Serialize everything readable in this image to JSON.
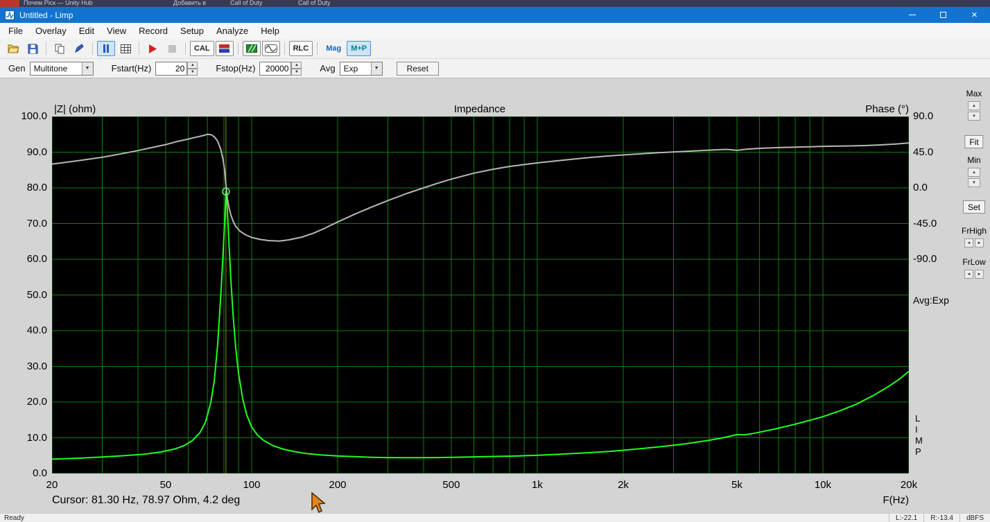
{
  "background_tabs": {
    "fragments": [
      "Почем Ріск — Unity Hub",
      "Добавить в",
      "Call of Duty",
      "Call of Duty"
    ]
  },
  "window": {
    "title": "Untitled - Limp"
  },
  "menubar": {
    "items": [
      "File",
      "Overlay",
      "Edit",
      "View",
      "Record",
      "Setup",
      "Analyze",
      "Help"
    ]
  },
  "toolbar": {
    "icons": [
      "open-file-icon",
      "save-icon",
      "copy-icon",
      "pen-icon",
      "pause-icon",
      "table-icon",
      "record-icon",
      "stop-icon",
      "color-bars-icon",
      "spectrum-icon",
      "waveform-icon"
    ],
    "cal_label": "CAL",
    "rlc_label": "RLC",
    "mag_label": "Mag",
    "mp_label": "M+P"
  },
  "controls": {
    "gen_label": "Gen",
    "gen_value": "Multitone",
    "fstart_label": "Fstart(Hz)",
    "fstart_value": "20",
    "fstop_label": "Fstop(Hz)",
    "fstop_value": "20000",
    "avg_label": "Avg",
    "avg_value": "Exp",
    "reset_label": "Reset"
  },
  "chart_data": {
    "type": "line",
    "title": "Impedance",
    "ylabel_left": "|Z| (ohm)",
    "ylabel_right": "Phase (°)",
    "xlabel": "F(Hz)",
    "x_scale": "log",
    "fmin": 20,
    "fmax": 20000,
    "grid": true,
    "z_axis": {
      "min": 0,
      "max": 100,
      "ticks": [
        "100.0",
        "90.0",
        "80.0",
        "70.0",
        "60.0",
        "50.0",
        "40.0",
        "30.0",
        "20.0",
        "10.0",
        "0.0"
      ]
    },
    "phase_axis": {
      "min": -90,
      "max": 90,
      "ticks": [
        "90.0",
        "45.0",
        "0.0",
        "-45.0",
        "-90.0"
      ]
    },
    "x_ticks": [
      {
        "f": 20,
        "label": "20"
      },
      {
        "f": 50,
        "label": "50"
      },
      {
        "f": 100,
        "label": "100"
      },
      {
        "f": 200,
        "label": "200"
      },
      {
        "f": 500,
        "label": "500"
      },
      {
        "f": 1000,
        "label": "1k"
      },
      {
        "f": 2000,
        "label": "2k"
      },
      {
        "f": 5000,
        "label": "5k"
      },
      {
        "f": 10000,
        "label": "10k"
      },
      {
        "f": 20000,
        "label": "20k"
      }
    ],
    "cursor": {
      "freq": 81.3,
      "z": 78.97,
      "phase": 4.2,
      "readout": "Cursor: 81.30 Hz, 78.97 Ohm, 4.2 deg"
    },
    "colors": {
      "plot_bg": "#000000",
      "grid": "#0e800e",
      "cursor_line": "#8b8b00",
      "marker": "#5cff5c"
    },
    "series": [
      {
        "name": "impedance",
        "axis": "z",
        "color": "#1fff1f",
        "points": [
          [
            20,
            4.0
          ],
          [
            25,
            4.3
          ],
          [
            30,
            4.6
          ],
          [
            36,
            5.0
          ],
          [
            42,
            5.4
          ],
          [
            48,
            6.0
          ],
          [
            54,
            6.9
          ],
          [
            58,
            7.8
          ],
          [
            62,
            9.2
          ],
          [
            66,
            11.5
          ],
          [
            69,
            14.5
          ],
          [
            72,
            20
          ],
          [
            74,
            26
          ],
          [
            76,
            36
          ],
          [
            78,
            50
          ],
          [
            79.5,
            62
          ],
          [
            80.5,
            71
          ],
          [
            81.3,
            78.97
          ],
          [
            82.2,
            74
          ],
          [
            83.2,
            65
          ],
          [
            84.5,
            55
          ],
          [
            86,
            45
          ],
          [
            88,
            35
          ],
          [
            90,
            28
          ],
          [
            93,
            21
          ],
          [
            96,
            16.5
          ],
          [
            100,
            13
          ],
          [
            105,
            10.7
          ],
          [
            110,
            9.3
          ],
          [
            118,
            7.9
          ],
          [
            128,
            6.9
          ],
          [
            140,
            6.2
          ],
          [
            155,
            5.6
          ],
          [
            175,
            5.2
          ],
          [
            200,
            4.9
          ],
          [
            230,
            4.7
          ],
          [
            260,
            4.55
          ],
          [
            300,
            4.45
          ],
          [
            360,
            4.4
          ],
          [
            430,
            4.45
          ],
          [
            500,
            4.5
          ],
          [
            600,
            4.65
          ],
          [
            700,
            4.75
          ],
          [
            850,
            4.9
          ],
          [
            1000,
            5.1
          ],
          [
            1200,
            5.4
          ],
          [
            1500,
            5.8
          ],
          [
            1800,
            6.2
          ],
          [
            2200,
            6.8
          ],
          [
            2700,
            7.5
          ],
          [
            3300,
            8.3
          ],
          [
            4000,
            9.3
          ],
          [
            4600,
            10.2
          ],
          [
            5000,
            10.9
          ],
          [
            5300,
            10.8
          ],
          [
            5700,
            11.2
          ],
          [
            6300,
            11.9
          ],
          [
            7000,
            12.7
          ],
          [
            8000,
            13.8
          ],
          [
            9000,
            14.9
          ],
          [
            10000,
            15.9
          ],
          [
            11500,
            17.6
          ],
          [
            13000,
            19.3
          ],
          [
            15000,
            21.8
          ],
          [
            17000,
            24.4
          ],
          [
            18500,
            26.4
          ],
          [
            20000,
            28.6
          ]
        ]
      },
      {
        "name": "phase",
        "axis": "phase",
        "color": "#b8b8b8",
        "points": [
          [
            20,
            30
          ],
          [
            25,
            34.5
          ],
          [
            30,
            38.5
          ],
          [
            35,
            43
          ],
          [
            40,
            47
          ],
          [
            45,
            51
          ],
          [
            50,
            54.5
          ],
          [
            55,
            58.5
          ],
          [
            60,
            61.5
          ],
          [
            64,
            64
          ],
          [
            67,
            65.5
          ],
          [
            70,
            67.5
          ],
          [
            72,
            67
          ],
          [
            74,
            64.5
          ],
          [
            76,
            59
          ],
          [
            78,
            48.5
          ],
          [
            79.5,
            35
          ],
          [
            80.5,
            21
          ],
          [
            81.3,
            4.2
          ],
          [
            82.2,
            -13
          ],
          [
            83.2,
            -24
          ],
          [
            84.5,
            -33.5
          ],
          [
            86,
            -41.5
          ],
          [
            88,
            -48.5
          ],
          [
            91,
            -54.5
          ],
          [
            95,
            -59
          ],
          [
            100,
            -62.5
          ],
          [
            107,
            -65
          ],
          [
            115,
            -66.5
          ],
          [
            125,
            -67
          ],
          [
            135,
            -65.5
          ],
          [
            150,
            -62
          ],
          [
            165,
            -57
          ],
          [
            180,
            -51
          ],
          [
            200,
            -43
          ],
          [
            230,
            -33
          ],
          [
            260,
            -25
          ],
          [
            300,
            -16
          ],
          [
            350,
            -7
          ],
          [
            400,
            0
          ],
          [
            450,
            6
          ],
          [
            500,
            11
          ],
          [
            600,
            18.5
          ],
          [
            700,
            23.5
          ],
          [
            800,
            27
          ],
          [
            1000,
            31.5
          ],
          [
            1200,
            34.5
          ],
          [
            1500,
            38
          ],
          [
            1800,
            40.5
          ],
          [
            2200,
            42.5
          ],
          [
            2700,
            44.5
          ],
          [
            3300,
            46
          ],
          [
            4000,
            47.5
          ],
          [
            4600,
            48.5
          ],
          [
            5000,
            47.3
          ],
          [
            5400,
            48.8
          ],
          [
            6000,
            49.8
          ],
          [
            7000,
            50.8
          ],
          [
            8000,
            51.3
          ],
          [
            9000,
            51.8
          ],
          [
            10000,
            52.3
          ],
          [
            12000,
            52.8
          ],
          [
            14000,
            53.3
          ],
          [
            16000,
            54.2
          ],
          [
            18000,
            55.2
          ],
          [
            20000,
            56.5
          ]
        ]
      }
    ]
  },
  "right_panel": {
    "max_label": "Max",
    "fit_label": "Fit",
    "min_label": "Min",
    "set_label": "Set",
    "frhigh_label": "FrHigh",
    "frlow_label": "FrLow",
    "avg_display": "Avg:Exp",
    "limp_vertical": "L\nI\nM\nP"
  },
  "statusbar": {
    "ready": "Ready",
    "left_level": "L:-22.1",
    "right_level": "R:-13.4",
    "unit": "dBFS"
  }
}
